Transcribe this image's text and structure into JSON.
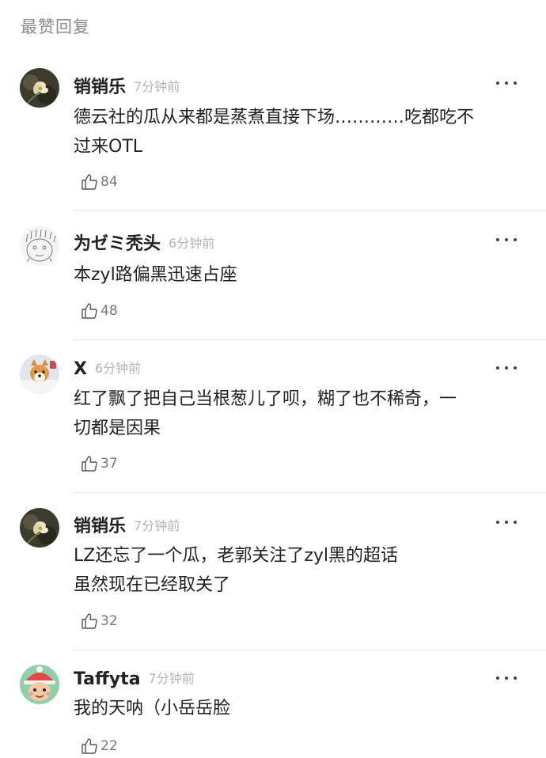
{
  "section_title": "最赞回复",
  "comments": [
    {
      "username": "销销乐",
      "time": "7分钟前",
      "content": "德云社的瓜从来都是蒸煮直接下场…………吃都吃不\n过来OTL",
      "likes": "84"
    },
    {
      "username": "为ゼミ秃头",
      "time": "6分钟前",
      "content": "本zyl路偏黑迅速占座",
      "likes": "48"
    },
    {
      "username": "X",
      "time": "6分钟前",
      "content": "红了飘了把自己当根葱儿了呗，糊了也不稀奇，一\n切都是因果",
      "likes": "37"
    },
    {
      "username": "销销乐",
      "time": "7分钟前",
      "content": "LZ还忘了一个瓜，老郭关注了zyl黑的超话\n虽然现在已经取关了",
      "likes": "32"
    },
    {
      "username": "Taffyta",
      "time": "7分钟前",
      "content": "我的天呐（小岳岳脸",
      "likes": "22"
    }
  ],
  "icons": {
    "like": "thumbs-up-outline-icon",
    "more": "more-dots-icon"
  },
  "colors": {
    "text": "#222222",
    "meta": "#b4b4b4",
    "divider": "#e6e6e6"
  }
}
